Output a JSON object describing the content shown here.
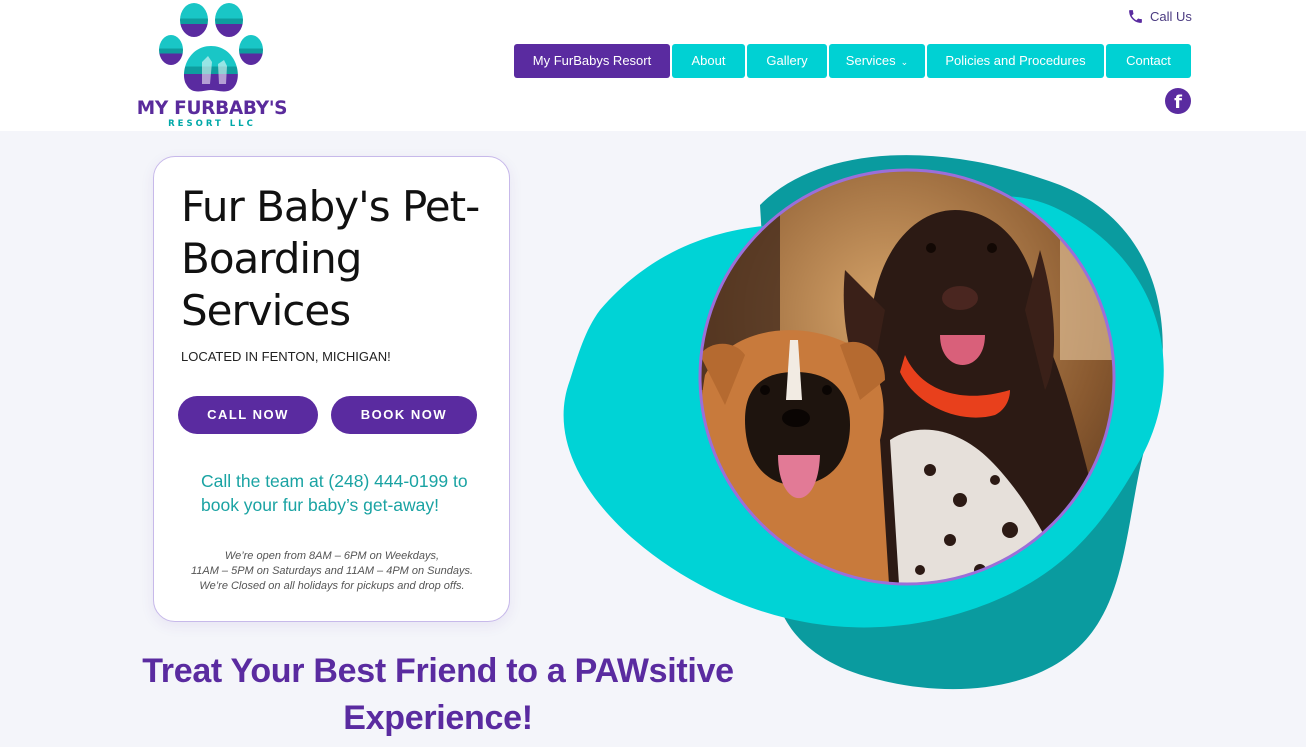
{
  "brand": {
    "logo_title": "MY FURBABY'S",
    "logo_subtitle": "RESORT LLC",
    "primary_color": "#5a2ba0",
    "accent_color": "#00d1d3"
  },
  "header": {
    "call_us_label": "Call Us",
    "nav": [
      {
        "label": "My FurBabys Resort",
        "active": true
      },
      {
        "label": "About"
      },
      {
        "label": "Gallery"
      },
      {
        "label": "Services",
        "dropdown_caret": "⌄"
      },
      {
        "label": "Policies and Procedures"
      },
      {
        "label": "Contact"
      }
    ],
    "social": {
      "facebook_glyph": "f"
    }
  },
  "hero": {
    "title": "Fur Baby's Pet-Boarding Services",
    "location": "LOCATED IN FENTON, MICHIGAN!",
    "call_button": "CALL NOW",
    "book_button": "BOOK NOW",
    "call_text": "Call the team at (248) 444-0199 to book your fur baby’s get-away!",
    "hours_line1": "We’re open from 8AM – 6PM on Weekdays,",
    "hours_line2": "11AM – 5PM on Saturdays and 11AM – 4PM on Sundays.",
    "hours_line3": "We’re Closed on all holidays for pickups and drop offs."
  },
  "tagline": "Treat Your Best Friend to a PAWsitive Experience!",
  "image": {
    "subject": "two-dogs-photo"
  }
}
